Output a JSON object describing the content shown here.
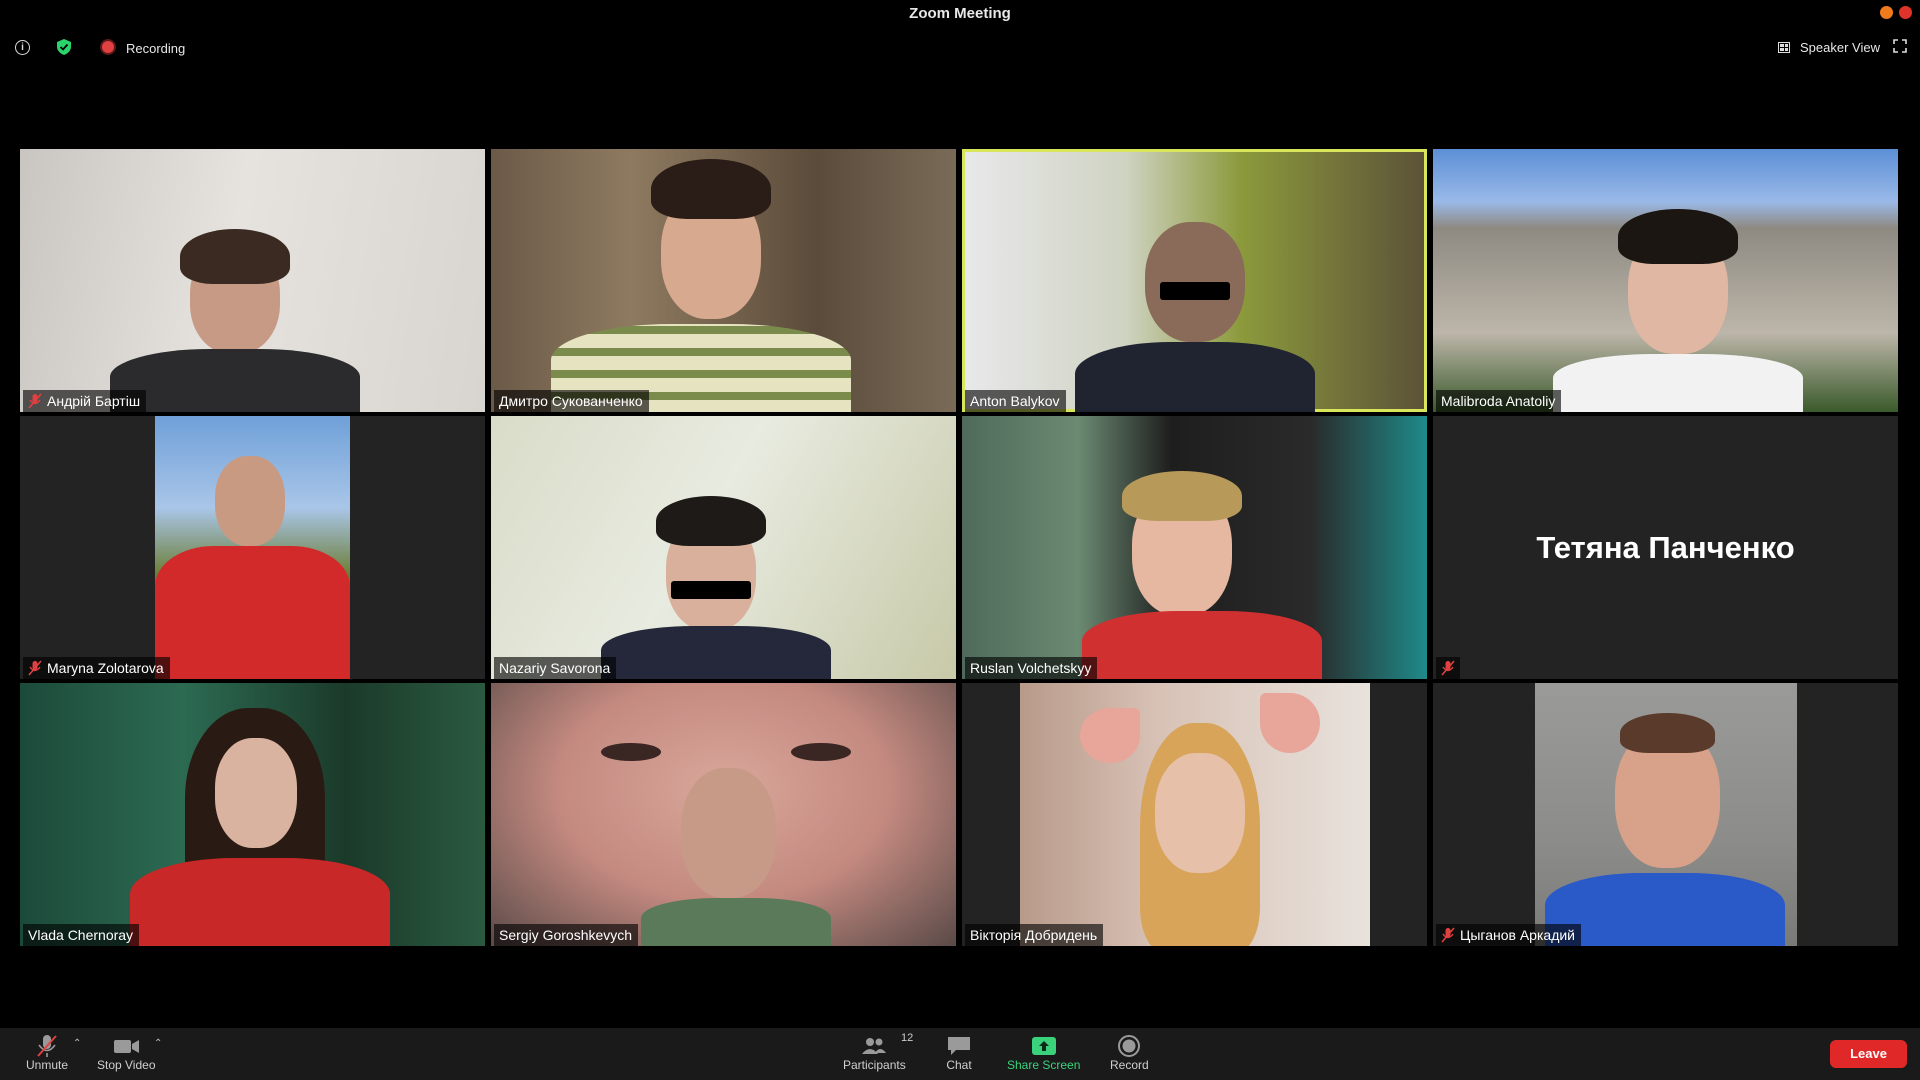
{
  "window": {
    "title": "Zoom Meeting"
  },
  "top": {
    "recording_label": "Recording",
    "view_label": "Speaker View"
  },
  "participants": [
    {
      "name": "Андрій Бартіш",
      "muted": true
    },
    {
      "name": "Дмитро Сукованченко",
      "muted": false
    },
    {
      "name": "Anton Balykov",
      "muted": false,
      "active_speaker": true
    },
    {
      "name": "Malibroda Anatoliy",
      "muted": false
    },
    {
      "name": "Maryna Zolotarova",
      "muted": true
    },
    {
      "name": "Nazariy Savorona",
      "muted": false
    },
    {
      "name": "Ruslan Volchetskyy",
      "muted": false
    },
    {
      "name": "Тетяна Панченко",
      "muted": true,
      "video_off": true
    },
    {
      "name": "Vlada Chernoray",
      "muted": false
    },
    {
      "name": "Sergiy Goroshkevych",
      "muted": false
    },
    {
      "name": "Вікторія Добридень",
      "muted": false
    },
    {
      "name": "Цыганов Аркадий",
      "muted": true
    }
  ],
  "toolbar": {
    "unmute_label": "Unmute",
    "stop_video_label": "Stop Video",
    "participants_label": "Participants",
    "participants_count": "12",
    "chat_label": "Chat",
    "share_label": "Share Screen",
    "record_label": "Record",
    "leave_label": "Leave"
  },
  "colors": {
    "active_border": "#d9e55a",
    "share_green": "#3ad37b",
    "leave_red": "#e02828",
    "recording_red": "#e04040"
  }
}
